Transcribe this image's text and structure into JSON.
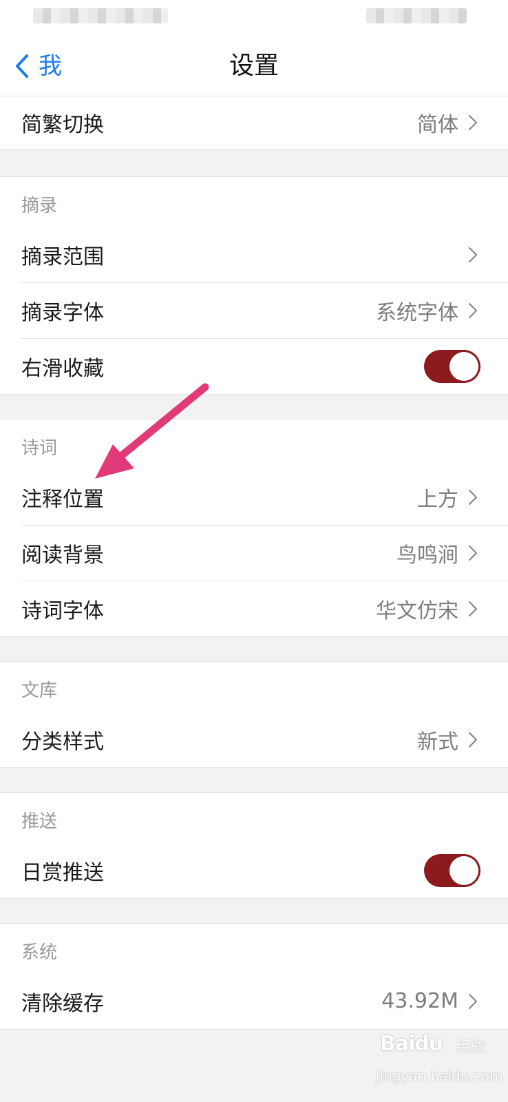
{
  "nav": {
    "back_label": "我",
    "title": "设置"
  },
  "general": {
    "items": [
      {
        "label": "简繁切换",
        "value": "简体"
      }
    ]
  },
  "excerpt": {
    "header": "摘录",
    "items": [
      {
        "label": "摘录范围",
        "value": ""
      },
      {
        "label": "摘录字体",
        "value": "系统字体"
      },
      {
        "label": "右滑收藏",
        "toggle": true
      }
    ]
  },
  "poetry": {
    "header": "诗词",
    "items": [
      {
        "label": "注释位置",
        "value": "上方"
      },
      {
        "label": "阅读背景",
        "value": "鸟鸣涧"
      },
      {
        "label": "诗词字体",
        "value": "华文仿宋"
      }
    ]
  },
  "library": {
    "header": "文库",
    "items": [
      {
        "label": "分类样式",
        "value": "新式"
      }
    ]
  },
  "push": {
    "header": "推送",
    "items": [
      {
        "label": "日赏推送",
        "toggle": true
      }
    ]
  },
  "system": {
    "header": "系统",
    "items": [
      {
        "label": "清除缓存",
        "value": "43.92M"
      }
    ]
  },
  "watermark": {
    "brand": "Baidu",
    "suffix": "经验",
    "url": "jingyan.baidu.com"
  },
  "colors": {
    "accent_blue": "#1e7be8",
    "toggle_on": "#8b1b1f",
    "annotation_arrow": "#e23a78"
  }
}
